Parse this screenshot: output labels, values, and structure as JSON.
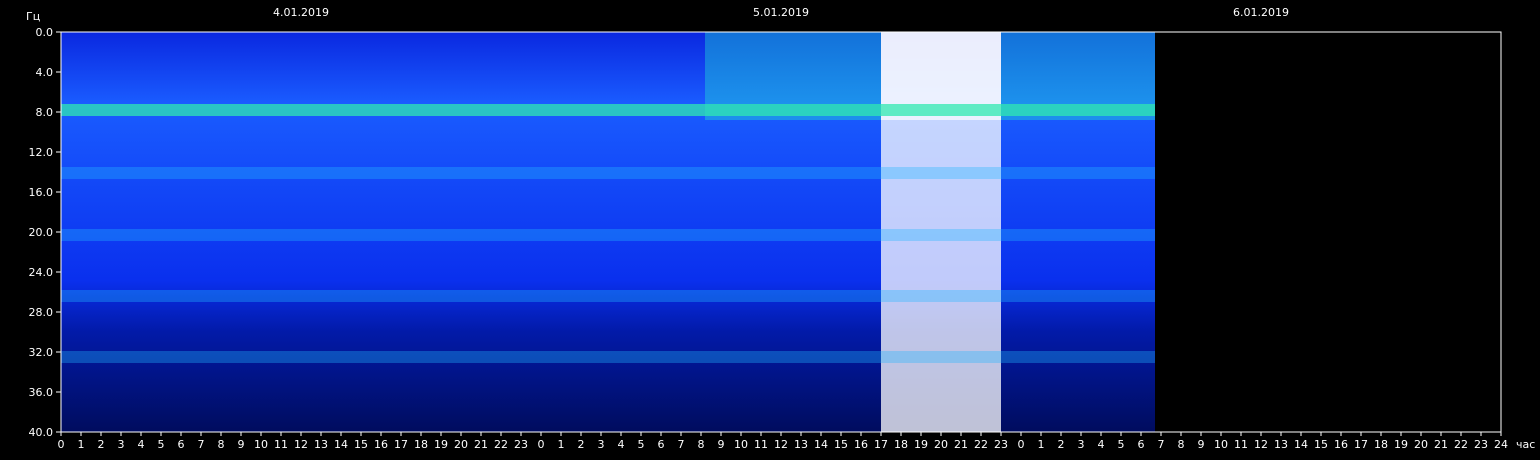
{
  "chart_data": {
    "type": "heatmap",
    "title": "",
    "ylabel": "Гц",
    "xlabel": "час",
    "dates": [
      "4.01.2019",
      "5.01.2019",
      "6.01.2019"
    ],
    "yticks": [
      "0.0",
      "4.0",
      "8.0",
      "12.0",
      "16.0",
      "20.0",
      "24.0",
      "28.0",
      "32.0",
      "36.0",
      "40.0"
    ],
    "ylim": [
      0,
      40
    ],
    "xticks": [
      "0",
      "1",
      "2",
      "3",
      "4",
      "5",
      "6",
      "7",
      "8",
      "9",
      "10",
      "11",
      "12",
      "13",
      "14",
      "15",
      "16",
      "17",
      "18",
      "19",
      "20",
      "21",
      "22",
      "23",
      "0",
      "1",
      "2",
      "3",
      "4",
      "5",
      "6",
      "7",
      "8",
      "9",
      "10",
      "11",
      "12",
      "13",
      "14",
      "15",
      "16",
      "17",
      "18",
      "19",
      "20",
      "21",
      "22",
      "23",
      "0",
      "1",
      "2",
      "3",
      "4",
      "5",
      "6",
      "7",
      "8",
      "9",
      "10",
      "11",
      "12",
      "13",
      "14",
      "15",
      "16",
      "17",
      "18",
      "19",
      "20",
      "21",
      "22",
      "23",
      "24"
    ],
    "xlim_hours": [
      0,
      72
    ],
    "data_end_hours": 54.7,
    "frequency_bands_hz": [
      7.8,
      14.1,
      20.3,
      26.4,
      32.5
    ],
    "background_color": "#000000",
    "colorscale": [
      "#000a8c",
      "#0a32ff",
      "#1fa0ff",
      "#22e8d0",
      "#40ff60",
      "#ff3020",
      "#ffffff"
    ],
    "intensity_profile": [
      {
        "start_h": 0,
        "end_h": 32.2,
        "level": 0.3
      },
      {
        "start_h": 32.2,
        "end_h": 41.0,
        "level": 0.55
      },
      {
        "start_h": 41.0,
        "end_h": 47.0,
        "level": 0.95
      },
      {
        "start_h": 47.0,
        "end_h": 54.7,
        "level": 0.55
      }
    ]
  }
}
